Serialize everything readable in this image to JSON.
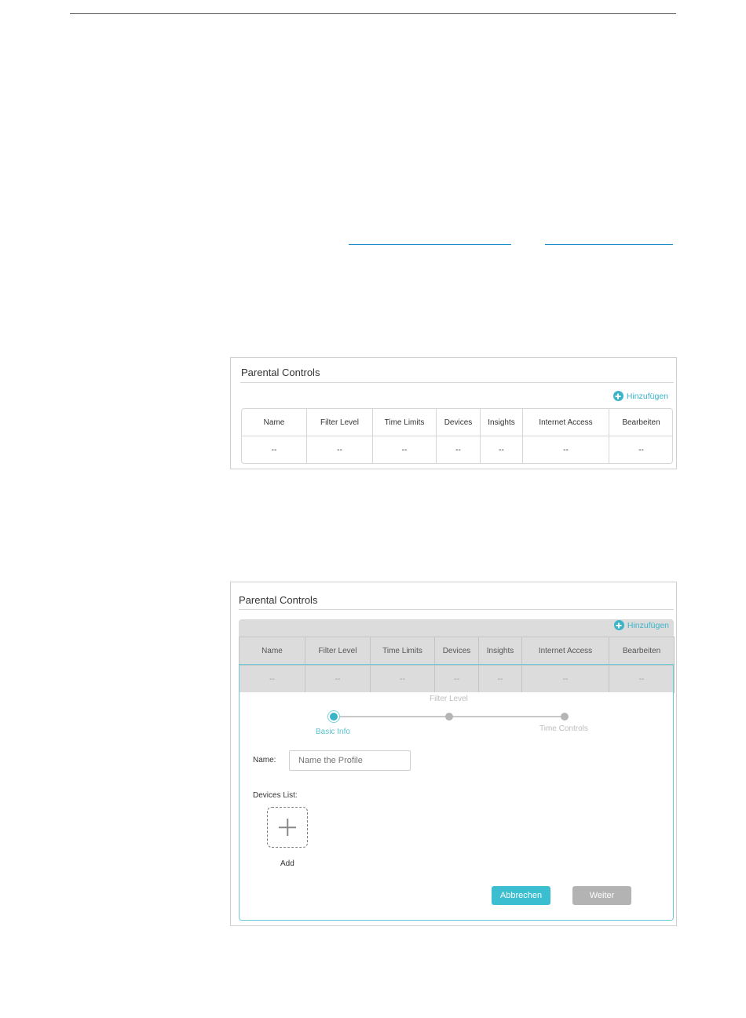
{
  "panel1": {
    "title": "Parental Controls",
    "add_label": "Hinzufügen",
    "columns": [
      "Name",
      "Filter Level",
      "Time Limits",
      "Devices",
      "Insights",
      "Internet Access",
      "Bearbeiten"
    ],
    "row": [
      "--",
      "--",
      "--",
      "--",
      "--",
      "--",
      "--"
    ]
  },
  "panel2": {
    "title": "Parental Controls",
    "add_label": "Hinzufügen",
    "columns": [
      "Name",
      "Filter Level",
      "Time Limits",
      "Devices",
      "Insights",
      "Internet Access",
      "Bearbeiten"
    ],
    "row": [
      "--",
      "--",
      "--",
      "--",
      "--",
      "--",
      "--"
    ],
    "steps": {
      "basic_info": "Basic Info",
      "filter_level": "Filter Level",
      "time_controls": "Time Controls"
    },
    "name_label": "Name:",
    "name_placeholder": "Name the Profile",
    "devices_label": "Devices List:",
    "add_device_label": "Add",
    "cancel_button": "Abbrechen",
    "next_button": "Weiter"
  },
  "colors": {
    "accent": "#3bb4c8",
    "link": "#1a8fc7",
    "disabled_button": "#b3b3b3"
  }
}
